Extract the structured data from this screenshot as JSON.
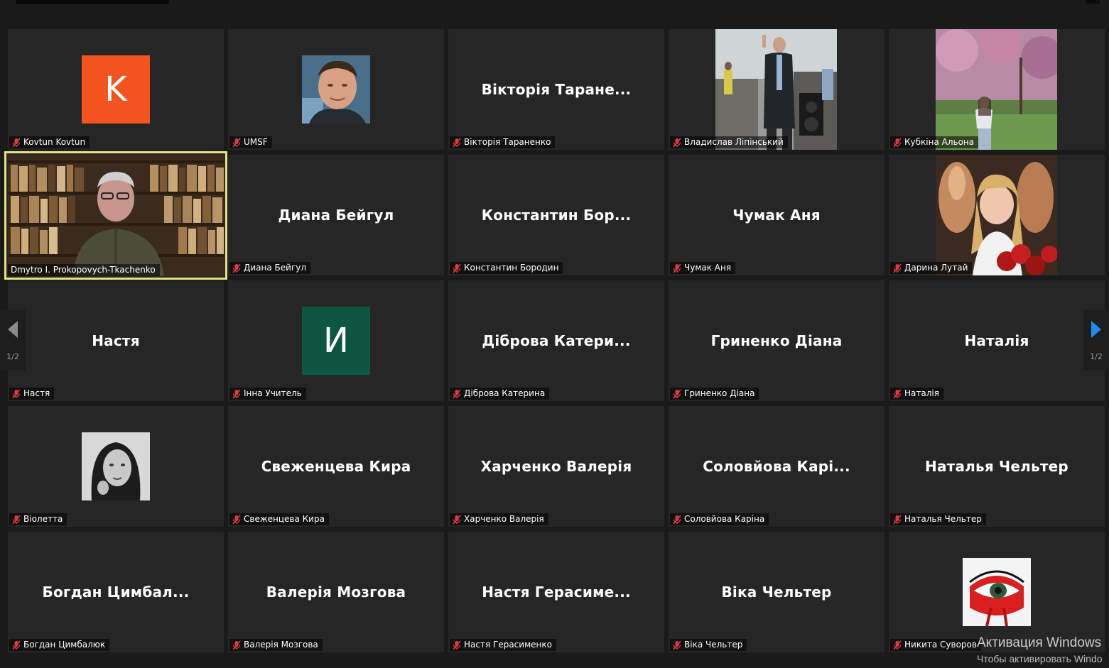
{
  "colors": {
    "background": "#1a1a1a",
    "tile": "#262626",
    "active_border": "#e8e27a",
    "mute_icon": "#e0393e",
    "next_arrow": "#1e8cf0"
  },
  "pagination": {
    "left": "1/2",
    "right": "1/2"
  },
  "tiles": [
    {
      "label": "Kovtun Kovtun",
      "initial": "K",
      "avatar_color": "#f3531f"
    },
    {
      "label": "UMSF"
    },
    {
      "label": "Вікторія Тараненко",
      "display": "Вікторія  Таране..."
    },
    {
      "label": "Владислав Ліпінський"
    },
    {
      "label": "Кубкіна Альона"
    },
    {
      "label": "Dmytro I. Prokopovych-Tkachenko"
    },
    {
      "label": "Диана Бейгул",
      "display": "Диана Бейгул"
    },
    {
      "label": "Константин Бородин",
      "display": "Константин  Бор..."
    },
    {
      "label": "Чумак Аня",
      "display": "Чумак Аня"
    },
    {
      "label": "Дарина Лутай"
    },
    {
      "label": "Настя",
      "display": "Настя"
    },
    {
      "label": "Інна Учитель",
      "initial": "И",
      "avatar_color": "#0d5640"
    },
    {
      "label": "Діброва Катерина",
      "display": "Діброва  Катери..."
    },
    {
      "label": "Гриненко Діана",
      "display": "Гриненко Діана"
    },
    {
      "label": "Наталія",
      "display": "Наталія"
    },
    {
      "label": "Віолетта"
    },
    {
      "label": "Свеженцева Кира",
      "display": "Свеженцева Кира"
    },
    {
      "label": "Харченко Валерія",
      "display": "Харченко Валерія"
    },
    {
      "label": "Соловйова Каріна",
      "display": "Соловйова  Карі..."
    },
    {
      "label": "Наталья Чельтер",
      "display": "Наталья Чельтер"
    },
    {
      "label": "Богдан Цимбалюк",
      "display": "Богдан  Цимбал..."
    },
    {
      "label": "Валерія Мозгова",
      "display": "Валерія Мозгова"
    },
    {
      "label": "Настя Герасименко",
      "display": "Настя  Герасиме..."
    },
    {
      "label": "Віка Чельтер",
      "display": "Віка Чельтер"
    },
    {
      "label": "Никита Суворов"
    }
  ],
  "windows_activation": {
    "title": "Активация Windows",
    "subtitle": "Чтобы активировать Windo"
  }
}
